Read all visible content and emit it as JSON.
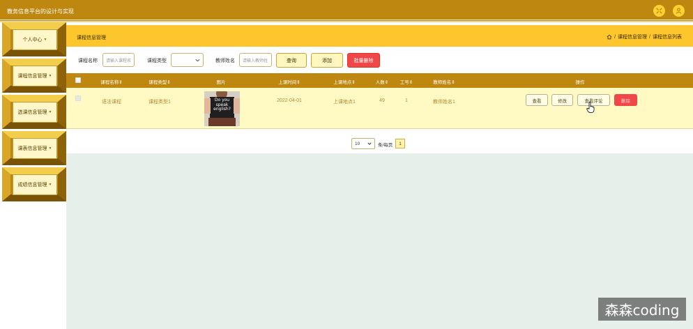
{
  "app": {
    "title": "教务信息平台的设计与实现"
  },
  "sidebar": {
    "items": [
      {
        "label": "个人中心"
      },
      {
        "label": "课程信息管理"
      },
      {
        "label": "选课信息管理"
      },
      {
        "label": "课表信息管理"
      },
      {
        "label": "成绩信息管理"
      }
    ]
  },
  "page": {
    "title": "课程信息管理",
    "breadcrumb": [
      "课程信息管理",
      "课程信息列表"
    ],
    "breadcrumb_sep": "/"
  },
  "search": {
    "course_name_label": "课程名称",
    "course_name_placeholder": "请输入课程名",
    "course_type_label": "课程类型",
    "teacher_name_label": "教师姓名",
    "teacher_name_placeholder": "请输入教师姓",
    "query_label": "查询",
    "add_label": "添加",
    "batch_delete_label": "批量删除"
  },
  "table": {
    "headers": [
      "课程名称",
      "课程类型",
      "图片",
      "上课时间",
      "上课地点",
      "人数",
      "工号",
      "教师姓名",
      "操作"
    ],
    "rows": [
      {
        "course_name": "语法课程",
        "course_type": "课程类型1",
        "image_text": "Do you speak english?",
        "time": "2022-04-01",
        "location": "上课地点1",
        "count": "49",
        "job_no": "1",
        "teacher": "教师姓名1",
        "actions": {
          "view": "查看",
          "edit": "修改",
          "view_comments": "查看评论",
          "delete": "删除"
        }
      }
    ]
  },
  "pagination": {
    "page_size": "10",
    "per_page_label": "条/每页",
    "current_page": "1"
  },
  "watermark": "森森coding",
  "colors": {
    "brand": "#be870f",
    "accent": "#fec62d",
    "row_bg": "#fff9c4",
    "danger": "#f04848"
  }
}
